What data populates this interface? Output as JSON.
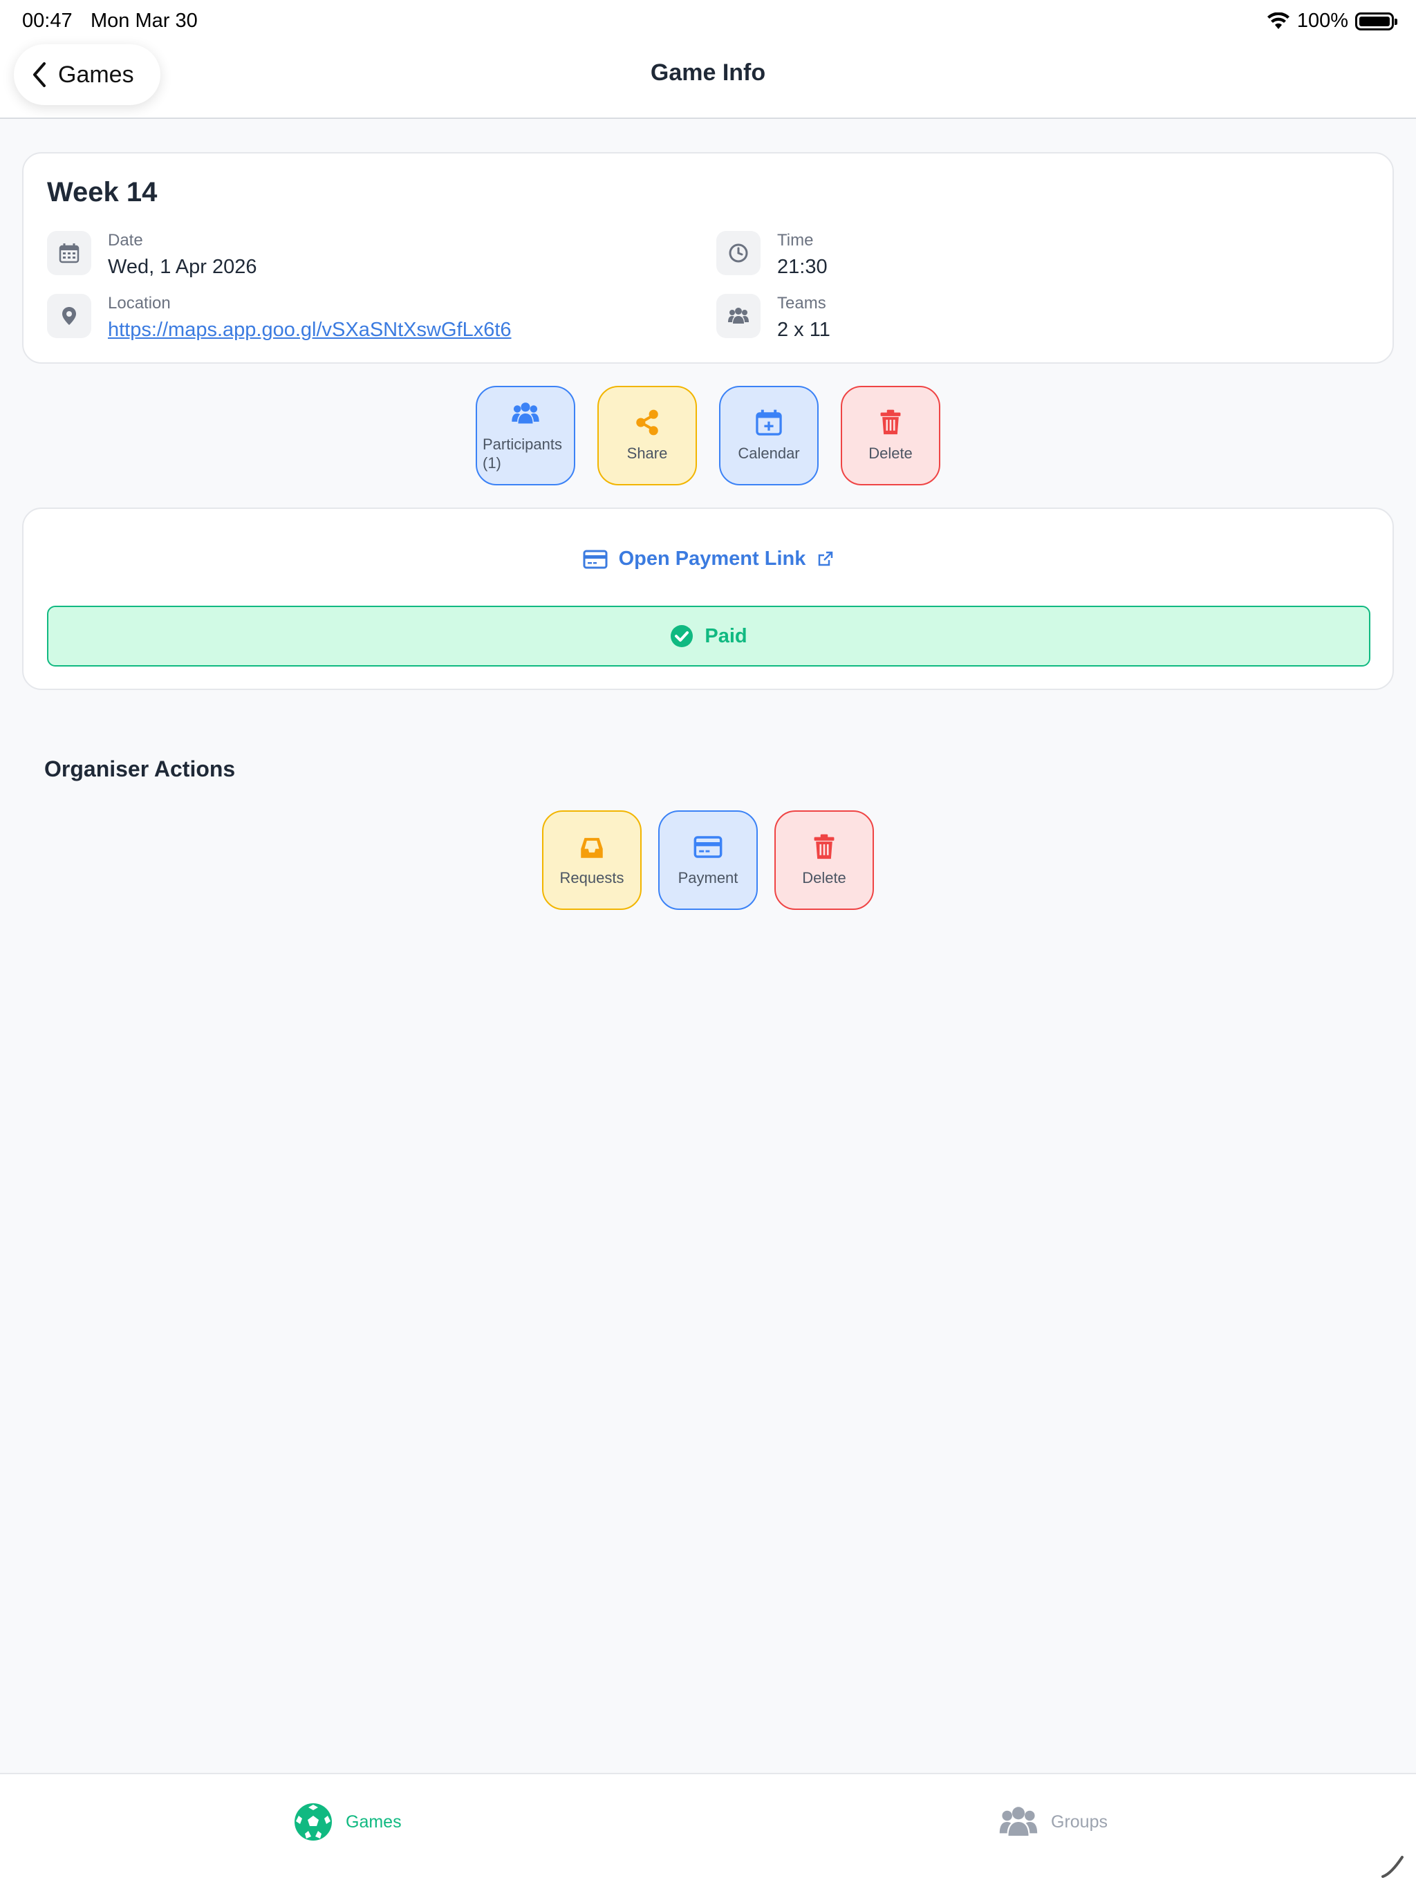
{
  "status_bar": {
    "time": "00:47",
    "date": "Mon Mar 30",
    "battery": "100%"
  },
  "nav": {
    "back_label": "Games",
    "title": "Game Info"
  },
  "game": {
    "title": "Week 14",
    "date_label": "Date",
    "date_value": "Wed, 1 Apr 2026",
    "time_label": "Time",
    "time_value": "21:30",
    "location_label": "Location",
    "location_value": "https://maps.app.goo.gl/vSXaSNtXswGfLx6t6",
    "teams_label": "Teams",
    "teams_value": "2 x 11"
  },
  "actions": {
    "participants": "Participants (1)",
    "share": "Share",
    "calendar": "Calendar",
    "delete": "Delete"
  },
  "payment": {
    "link_label": "Open Payment Link",
    "status": "Paid"
  },
  "organiser": {
    "title": "Organiser Actions",
    "requests": "Requests",
    "payment": "Payment",
    "delete": "Delete"
  },
  "tabbar": {
    "games": "Games",
    "groups": "Groups"
  },
  "colors": {
    "accent_blue": "#3b7be0",
    "success_green": "#10b981",
    "warning_yellow": "#f2b500",
    "danger_red": "#ef4444",
    "inactive_gray": "#9ca3af"
  }
}
